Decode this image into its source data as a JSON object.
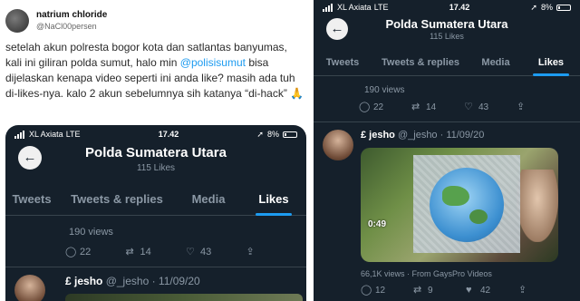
{
  "tweet": {
    "display_name": "natrium chloride",
    "handle": "@NaCl00persen",
    "text_before": "setelah akun polresta bogor kota dan satlantas banyumas, kali ini giliran polda sumut, halo min ",
    "mention": "@polisisumut",
    "text_after": " bisa dijelaskan kenapa video seperti ini anda like? masih ada tuh di-likes-nya. kalo 2 akun sebelumnya sih katanya “di-hack” 🙏"
  },
  "left_screen": {
    "status": {
      "carrier": "XL Axiata",
      "network": "LTE",
      "time": "17.42",
      "battery": "8%"
    },
    "profile": {
      "name": "Polda Sumatera Utara",
      "likes": "115 Likes"
    },
    "tabs": [
      "Tweets",
      "Tweets & replies",
      "Media",
      "Likes"
    ],
    "views": "190 views",
    "actions": {
      "replies": "22",
      "retweets": "14",
      "likes": "43"
    },
    "post": {
      "name": "£ jesho",
      "meta": "@_jesho · 11/09/20"
    }
  },
  "right_screen": {
    "status": {
      "carrier": "XL Axiata",
      "network": "LTE",
      "time": "17.42",
      "battery": "8%"
    },
    "profile": {
      "name": "Polda Sumatera Utara",
      "likes": "115 Likes"
    },
    "tabs": [
      "Tweets",
      "Tweets & replies",
      "Media",
      "Likes"
    ],
    "views": "190 views",
    "actions": {
      "replies": "22",
      "retweets": "14",
      "likes": "43"
    },
    "post": {
      "name": "£ jesho",
      "meta": "@_jesho · 11/09/20",
      "duration": "0:49",
      "video_meta": "66,1K views · From GaysPro Videos",
      "actions": {
        "replies": "12",
        "retweets": "9",
        "likes": "42"
      }
    }
  },
  "colors": {
    "background": "#15202b",
    "accent": "#1d9bf0",
    "muted": "#8b98a5"
  },
  "icons": [
    "back-arrow-icon",
    "reply-icon",
    "retweet-icon",
    "like-icon",
    "share-icon",
    "pin-icon"
  ]
}
